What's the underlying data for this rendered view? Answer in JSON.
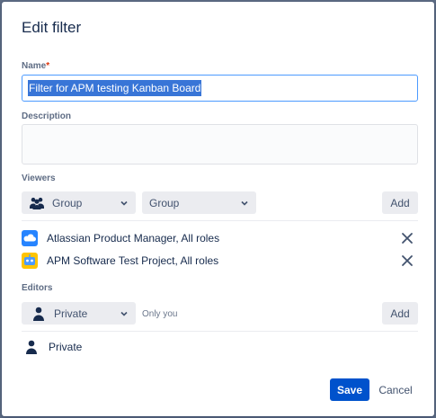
{
  "dialog": {
    "title": "Edit filter",
    "name_label": "Name",
    "required_mark": "*",
    "name_value": "Filter for APM testing Kanban Board",
    "description_label": "Description",
    "description_value": ""
  },
  "viewers": {
    "label": "Viewers",
    "type_select": "Group",
    "group_select": "Group",
    "add_label": "Add",
    "items": [
      {
        "label": "Atlassian Product Manager, All roles",
        "icon": "cloud-project-icon"
      },
      {
        "label": "APM Software Test Project, All roles",
        "icon": "robot-project-icon"
      }
    ]
  },
  "editors": {
    "label": "Editors",
    "type_select": "Private",
    "hint": "Only you",
    "add_label": "Add",
    "items": [
      {
        "label": "Private",
        "icon": "person-icon"
      }
    ]
  },
  "footer": {
    "save_label": "Save",
    "cancel_label": "Cancel"
  },
  "colors": {
    "primary": "#0052cc",
    "selection": "#3875d7",
    "focus_border": "#4c9aff"
  }
}
